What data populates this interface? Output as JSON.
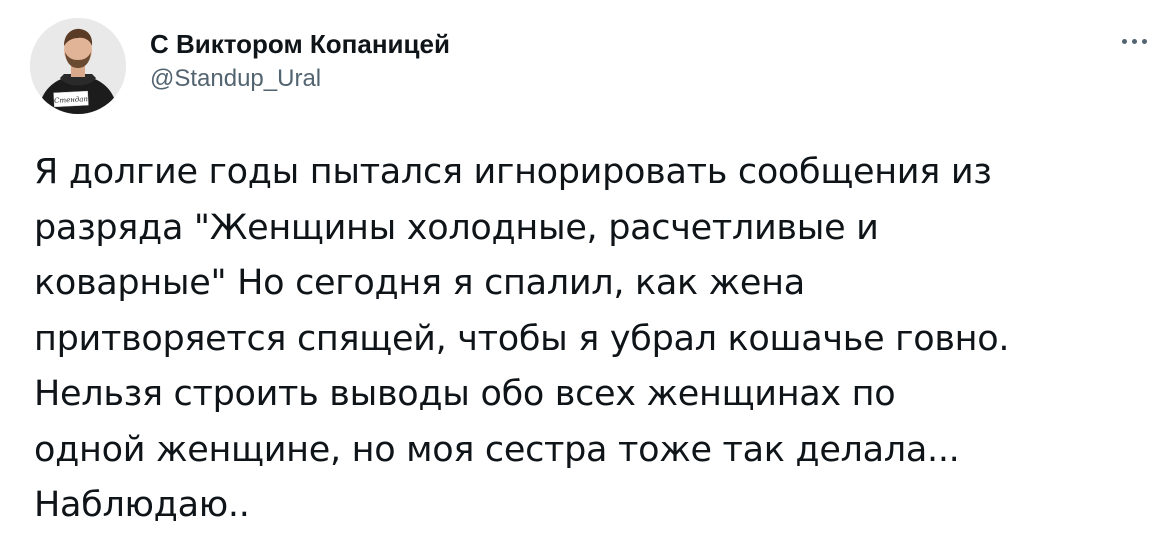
{
  "author": {
    "display_name": "С Виктором Копаницей",
    "handle": "@Standup_Ural",
    "avatar": "profile-photo",
    "avatar_sign_text": "Стендап"
  },
  "more_icon": "more-options-icon",
  "tweet": {
    "lines": [
      "Я долгие годы пытался игнорировать сообщения из",
      "разряда \"Женщины холодные, расчетливые и",
      "коварные\" Но сегодня я спалил, как жена",
      "притворяется спящей, чтобы я убрал кошачье говно.",
      "Нельзя строить выводы обо всех женщинах по",
      "одной женщине, но моя сестра тоже так делала...",
      "Наблюдаю.."
    ]
  },
  "colors": {
    "text": "#0f1419",
    "secondary_text": "#536471",
    "background": "#ffffff"
  }
}
